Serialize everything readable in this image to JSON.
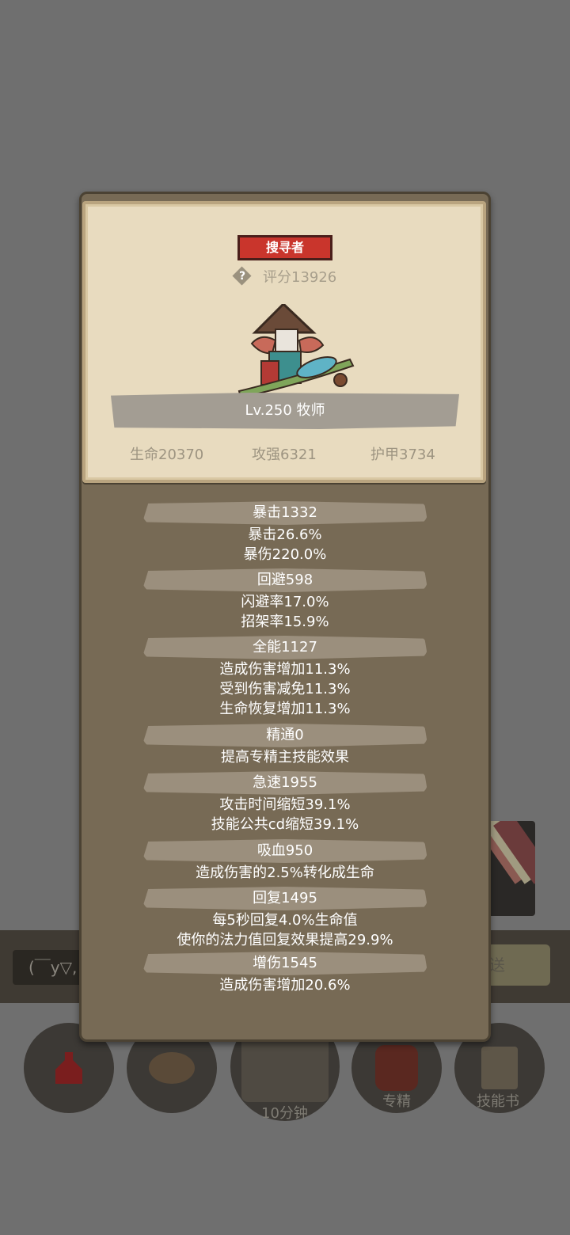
{
  "background": {
    "chat_placeholder": "(￣y▽,",
    "send_label": "送",
    "bottom_buttons": [
      {
        "label": ""
      },
      {
        "label": ""
      },
      {
        "label": "10分钟"
      },
      {
        "label": "专精"
      },
      {
        "label": "技能书"
      }
    ]
  },
  "header": {
    "class_badge": "搜寻者",
    "help_icon": "?",
    "score": "评分13926",
    "name_level": "Lv.250 牧师",
    "stats": [
      "生命20370",
      "攻强6321",
      "护甲3734"
    ]
  },
  "attributes": [
    {
      "title": "暴击1332",
      "lines": [
        "暴击26.6%",
        "暴伤220.0%"
      ]
    },
    {
      "title": "回避598",
      "lines": [
        "闪避率17.0%",
        "招架率15.9%"
      ]
    },
    {
      "title": "全能1127",
      "lines": [
        "造成伤害增加11.3%",
        "受到伤害减免11.3%",
        "生命恢复增加11.3%"
      ]
    },
    {
      "title": "精通0",
      "lines": [
        "提高专精主技能效果"
      ]
    },
    {
      "title": "急速1955",
      "lines": [
        "攻击时间缩短39.1%",
        "技能公共cd缩短39.1%"
      ]
    },
    {
      "title": "吸血950",
      "lines": [
        "造成伤害的2.5%转化成生命"
      ]
    },
    {
      "title": "回复1495",
      "lines": [
        "每5秒回复4.0%生命值",
        "使你的法力值回复效果提高29.9%"
      ]
    },
    {
      "title": "增伤1545",
      "lines": [
        "造成伤害增加20.6%"
      ]
    }
  ],
  "colors": {
    "panel": "#776a55",
    "card": "#e8dbbf",
    "badge": "#c9352c"
  },
  "icons": {
    "help": "question-diamond-icon",
    "potion": "potion-icon",
    "bread": "bread-icon",
    "chest": "chest-icon",
    "spec": "spec-icon",
    "book": "skill-book-icon"
  }
}
